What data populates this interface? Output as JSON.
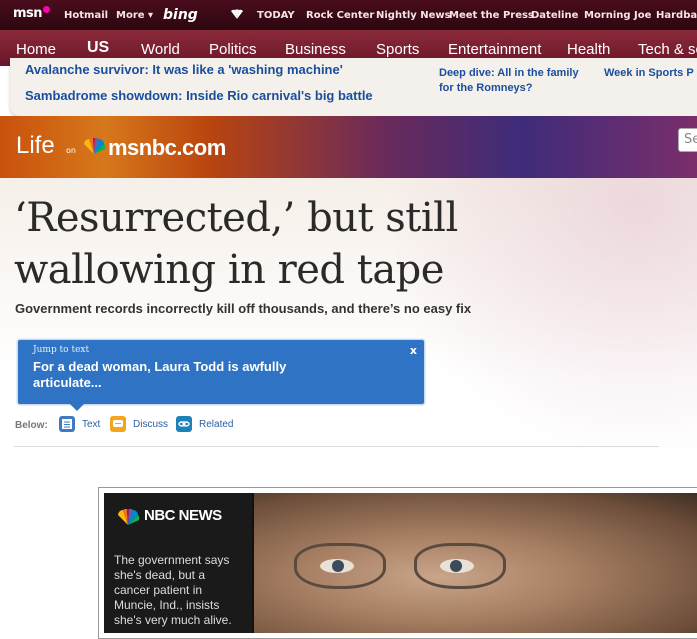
{
  "msnbar": {
    "logo": "msn",
    "items": [
      "Hotmail",
      "More",
      "bing",
      "TODAY",
      "Rock Center",
      "Nightly News",
      "Meet the Press",
      "Dateline",
      "Morning Joe",
      "Hardball"
    ]
  },
  "mainnav": {
    "items": [
      "Home",
      "US",
      "World",
      "Politics",
      "Business",
      "Sports",
      "Entertainment",
      "Health",
      "Tech & sc"
    ]
  },
  "headlines": {
    "left": [
      "Avalanche survivor: It was like a 'washing machine'",
      "Sambadrome showdown: Inside Rio carnival's big battle"
    ],
    "right1_line1": "Deep dive: All in the family",
    "right1_line2": "for the Romneys?",
    "right2": "Week in Sports P"
  },
  "banner": {
    "life": "Life",
    "on": "on",
    "brand": "msnbc.com",
    "search_placeholder": "Se"
  },
  "article": {
    "headline": "‘Resurrected,’ but still wallowing in red tape",
    "dek": "Government records incorrectly kill off thousands, and there’s no easy fix",
    "jump_title": "Jump to text",
    "jump_close": "x",
    "jump_text": "For a dead woman, Laura Todd is awfully articulate...",
    "below_label": "Below:",
    "below_links": [
      "Text",
      "Discuss",
      "Related"
    ]
  },
  "video": {
    "brand": "NBC NEWS",
    "description": "The government says she's dead, but a cancer patient in Muncie, Ind., insists she's very much alive."
  },
  "colors": {
    "link": "#1a4e9c",
    "jumpbox": "#2f73c4",
    "nav": "#7a1f32"
  }
}
